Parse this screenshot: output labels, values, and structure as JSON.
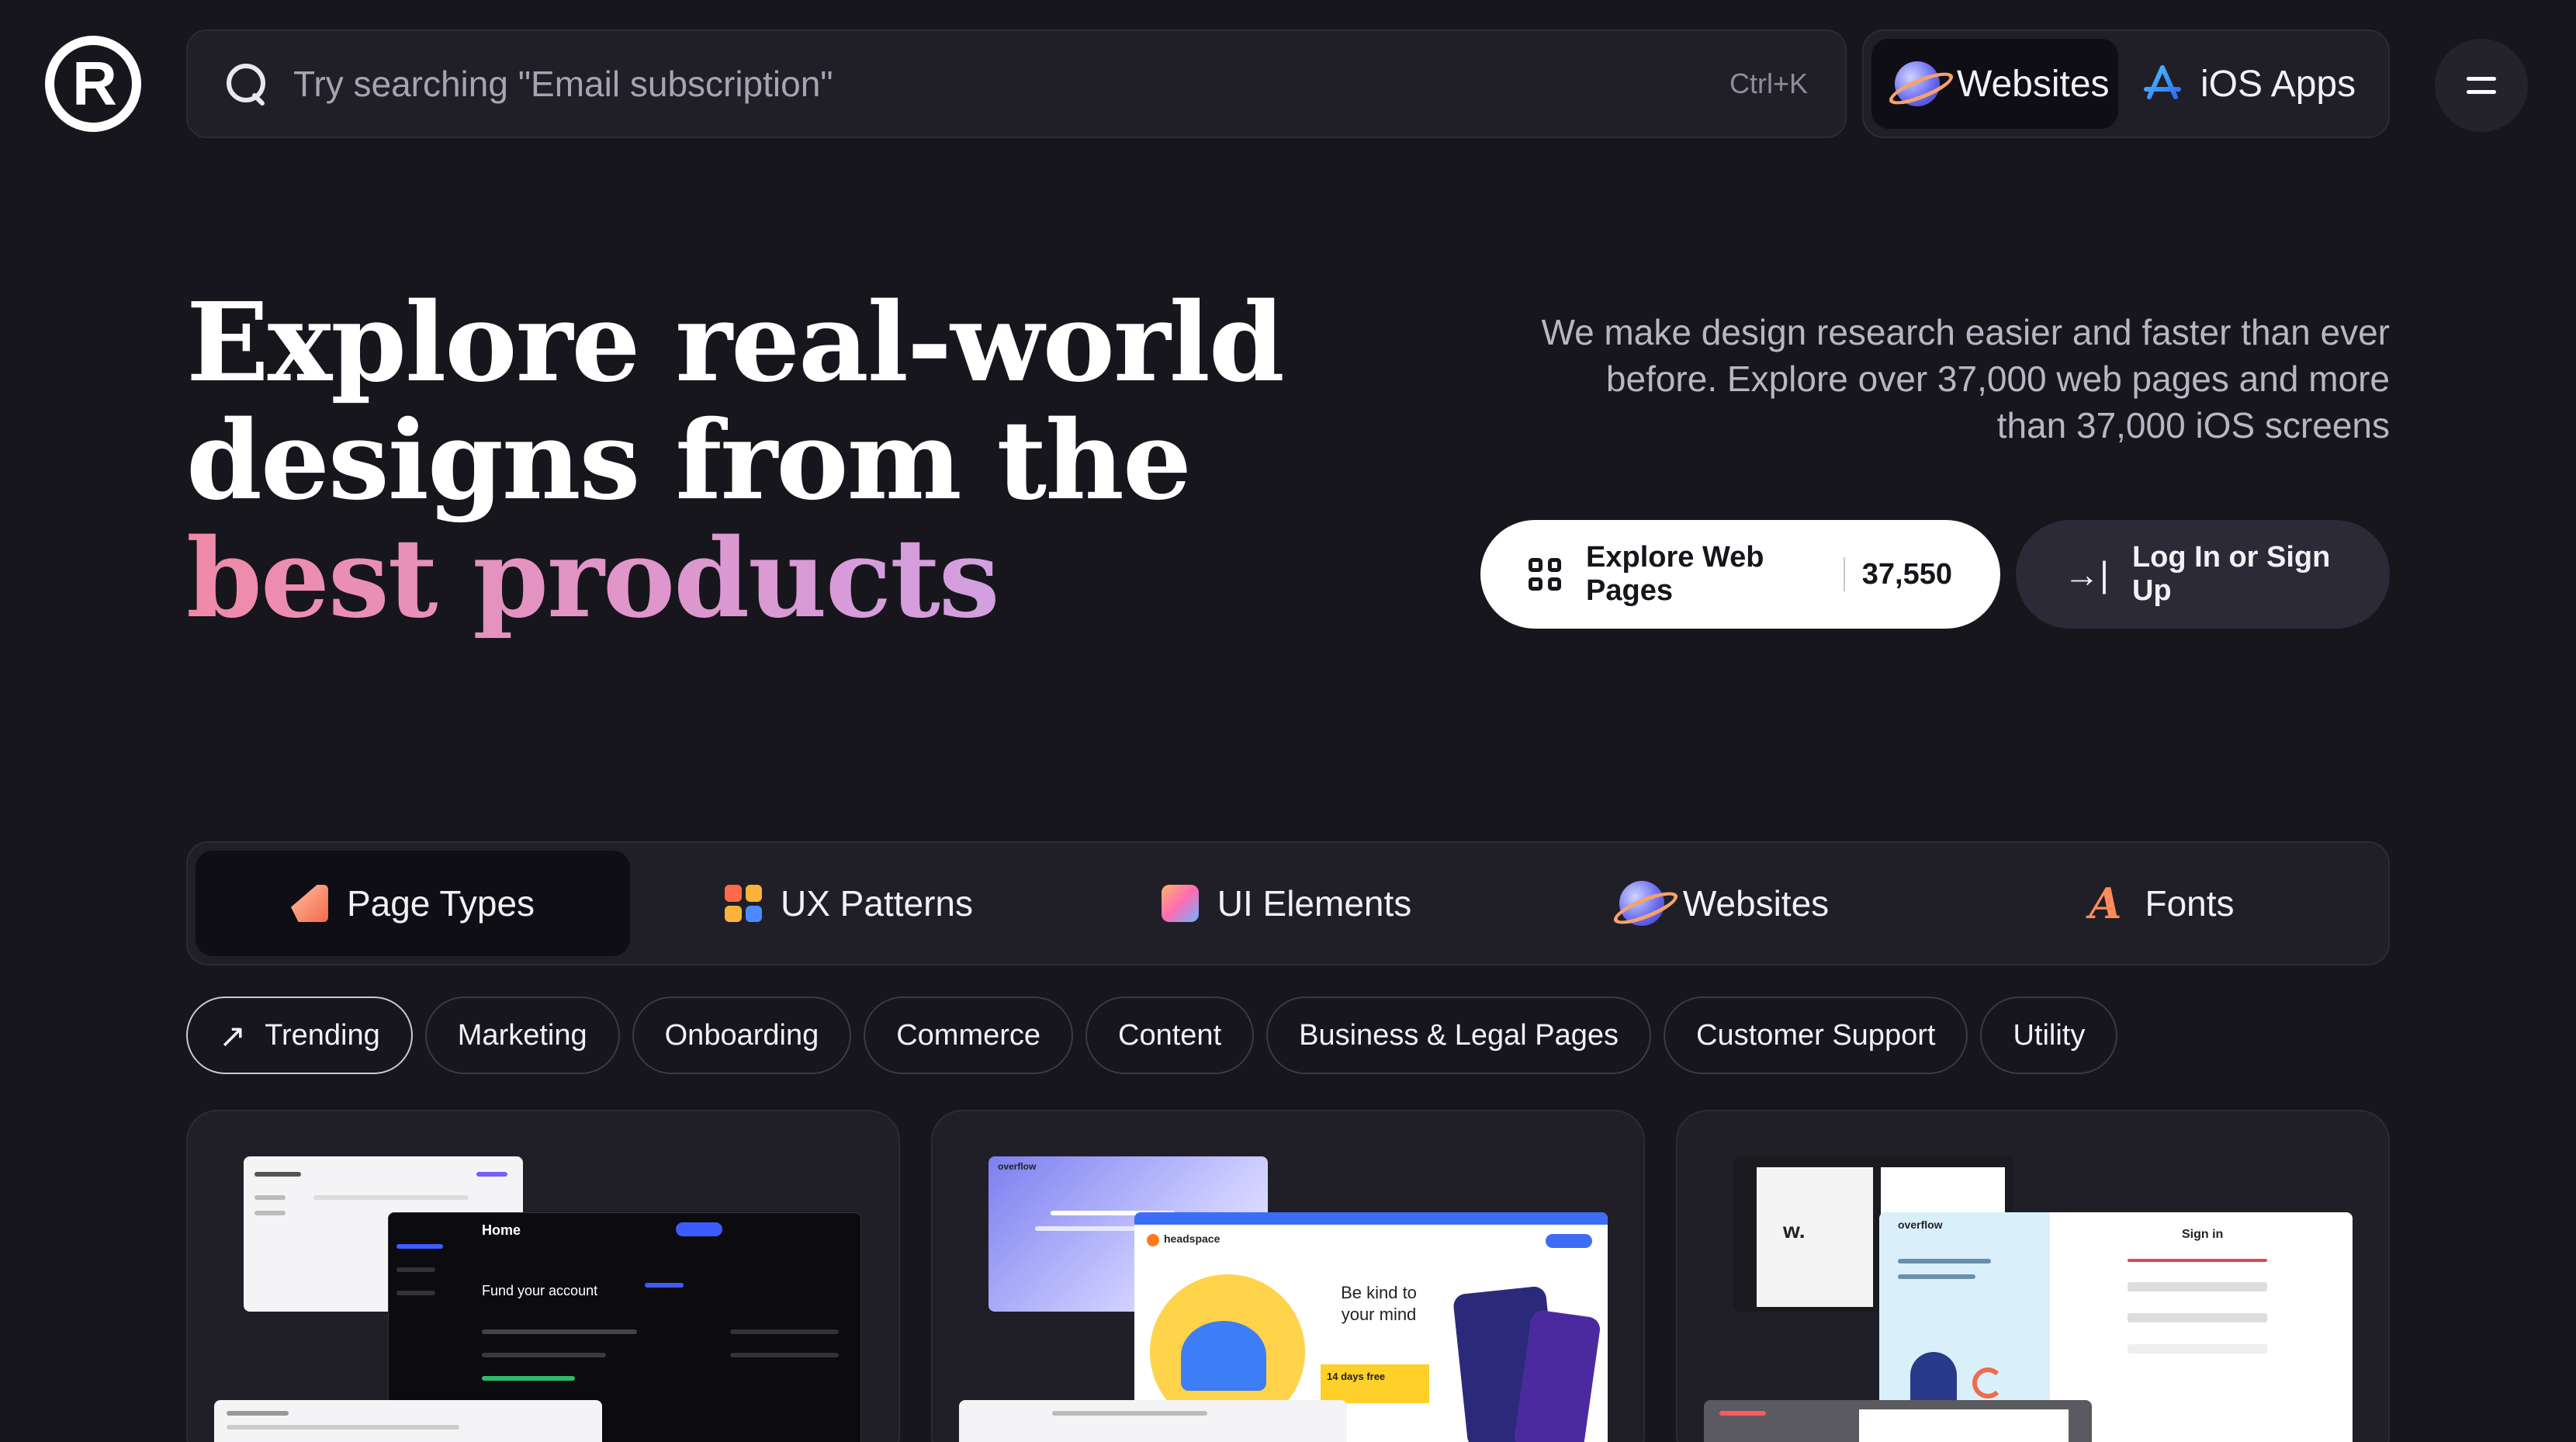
{
  "header": {
    "logo_letter": "R",
    "search_placeholder": "Try searching \"Email subscription\"",
    "search_shortcut": "Ctrl+K",
    "platforms": [
      {
        "label": "Websites",
        "icon": "planet-icon",
        "active": true
      },
      {
        "label": "iOS Apps",
        "icon": "app-store-icon",
        "active": false
      }
    ],
    "menu_icon": "menu-icon"
  },
  "hero": {
    "title_line1": "Explore real-world",
    "title_line2": "designs from the",
    "title_line3": "best products",
    "subtitle": "We make design research easier and faster than ever before. Explore over 37,000 web pages and more than 37,000 iOS screens",
    "cta_primary_label": "Explore Web Pages",
    "cta_primary_count": "37,550",
    "cta_secondary_label": "Log In or Sign Up",
    "accent_gradient": [
      "#f08aa8",
      "#c7a8f0"
    ]
  },
  "categories": [
    {
      "label": "Page Types",
      "icon": "page-types-icon",
      "active": true
    },
    {
      "label": "UX Patterns",
      "icon": "ux-patterns-icon",
      "active": false
    },
    {
      "label": "UI Elements",
      "icon": "ui-elements-icon",
      "active": false
    },
    {
      "label": "Websites",
      "icon": "planet-icon",
      "active": false
    },
    {
      "label": "Fonts",
      "icon": "fonts-icon",
      "active": false
    }
  ],
  "filters": [
    {
      "label": "Trending",
      "icon": "arrow-up-right-icon",
      "active": true
    },
    {
      "label": "Marketing"
    },
    {
      "label": "Onboarding"
    },
    {
      "label": "Commerce"
    },
    {
      "label": "Content"
    },
    {
      "label": "Business & Legal Pages"
    },
    {
      "label": "Customer Support"
    },
    {
      "label": "Utility"
    }
  ],
  "cards": {
    "card1": {
      "screen_title": "Fund your account",
      "screen_heading": "Home"
    },
    "card2": {
      "brand": "headspace",
      "headline": "Be kind to your mind",
      "promo": "14 days free",
      "other_brand": "overflow"
    },
    "card3": {
      "brand": "overflow",
      "login_title": "Sign in",
      "logo": "w."
    }
  },
  "colors": {
    "background": "#17161d",
    "surface": "#201f28",
    "text": "#f2f1f6",
    "muted": "#b7b6c3"
  }
}
